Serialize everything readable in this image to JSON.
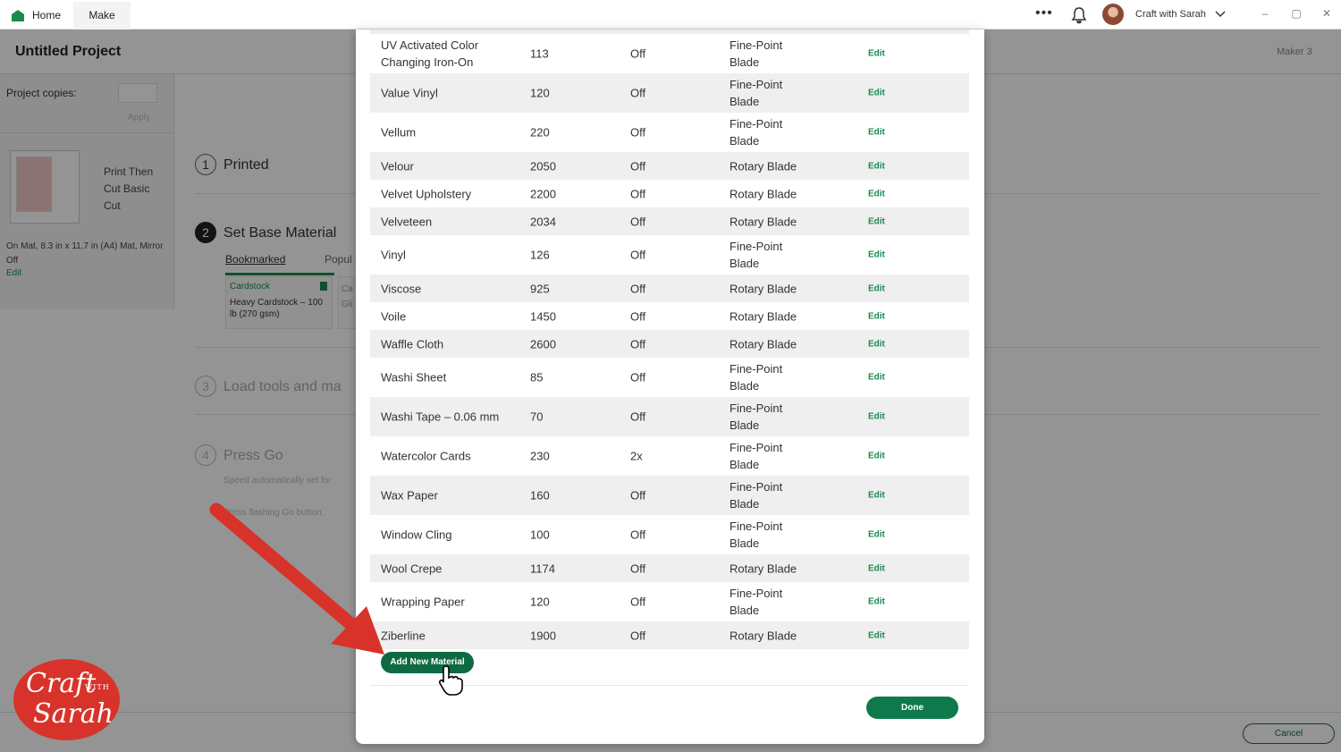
{
  "titlebar": {
    "tabs": [
      {
        "label": "Home"
      },
      {
        "label": "Make"
      }
    ],
    "account_name": "Craft with Sarah",
    "more": "•••",
    "win_min": "–",
    "win_max": "▢",
    "win_close": "✕"
  },
  "app": {
    "project_title": "Untitled Project",
    "machine": "Maker 3",
    "project_copies_label": "Project copies:",
    "apply_label": "Apply",
    "mat_type": "Print Then Cut Basic Cut",
    "mat_info": "On Mat, 8.3 in x 11.7 in (A4) Mat, Mirror Off",
    "mat_edit": "Edit",
    "steps": [
      {
        "num": "1",
        "label": "Printed"
      },
      {
        "num": "2",
        "label": "Set Base Material"
      },
      {
        "num": "3",
        "label": "Load tools and ma"
      },
      {
        "num": "4",
        "label": "Press Go"
      }
    ],
    "subtabs": {
      "bookmarked": "Bookmarked",
      "popular": "Popul"
    },
    "card": {
      "category": "Cardstock",
      "name": "Heavy Cardstock – 100 lb (270 gsm)"
    },
    "card2": {
      "category": "Ca",
      "name": "Gli"
    },
    "speed_text": "Speed automatically set for",
    "flash_text": "Press flashing Go button.",
    "cancel_label": "Cancel"
  },
  "materials": [
    {
      "name": "UV Activated Color Changing Iron-On",
      "pressure": "113",
      "multi_cut": "Off",
      "blade": "Fine-Point Blade",
      "edit": "Edit"
    },
    {
      "name": "Value Vinyl",
      "pressure": "120",
      "multi_cut": "Off",
      "blade": "Fine-Point Blade",
      "edit": "Edit"
    },
    {
      "name": "Vellum",
      "pressure": "220",
      "multi_cut": "Off",
      "blade": "Fine-Point Blade",
      "edit": "Edit"
    },
    {
      "name": "Velour",
      "pressure": "2050",
      "multi_cut": "Off",
      "blade": "Rotary Blade",
      "edit": "Edit"
    },
    {
      "name": "Velvet Upholstery",
      "pressure": "2200",
      "multi_cut": "Off",
      "blade": "Rotary Blade",
      "edit": "Edit"
    },
    {
      "name": "Velveteen",
      "pressure": "2034",
      "multi_cut": "Off",
      "blade": "Rotary Blade",
      "edit": "Edit"
    },
    {
      "name": "Vinyl",
      "pressure": "126",
      "multi_cut": "Off",
      "blade": "Fine-Point Blade",
      "edit": "Edit"
    },
    {
      "name": "Viscose",
      "pressure": "925",
      "multi_cut": "Off",
      "blade": "Rotary Blade",
      "edit": "Edit"
    },
    {
      "name": "Voile",
      "pressure": "1450",
      "multi_cut": "Off",
      "blade": "Rotary Blade",
      "edit": "Edit"
    },
    {
      "name": "Waffle Cloth",
      "pressure": "2600",
      "multi_cut": "Off",
      "blade": "Rotary Blade",
      "edit": "Edit"
    },
    {
      "name": "Washi Sheet",
      "pressure": "85",
      "multi_cut": "Off",
      "blade": "Fine-Point Blade",
      "edit": "Edit"
    },
    {
      "name": "Washi Tape – 0.06 mm",
      "pressure": "70",
      "multi_cut": "Off",
      "blade": "Fine-Point Blade",
      "edit": "Edit"
    },
    {
      "name": "Watercolor Cards",
      "pressure": "230",
      "multi_cut": "2x",
      "blade": "Fine-Point Blade",
      "edit": "Edit"
    },
    {
      "name": "Wax Paper",
      "pressure": "160",
      "multi_cut": "Off",
      "blade": "Fine-Point Blade",
      "edit": "Edit"
    },
    {
      "name": "Window Cling",
      "pressure": "100",
      "multi_cut": "Off",
      "blade": "Fine-Point Blade",
      "edit": "Edit"
    },
    {
      "name": "Wool Crepe",
      "pressure": "1174",
      "multi_cut": "Off",
      "blade": "Rotary Blade",
      "edit": "Edit"
    },
    {
      "name": "Wrapping Paper",
      "pressure": "120",
      "multi_cut": "Off",
      "blade": "Fine-Point Blade",
      "edit": "Edit"
    },
    {
      "name": "Ziberline",
      "pressure": "1900",
      "multi_cut": "Off",
      "blade": "Rotary Blade",
      "edit": "Edit"
    }
  ],
  "modal": {
    "add_new_material_label": "Add New Material",
    "done_label": "Done"
  },
  "logo": {
    "line1": "Craft",
    "line2": "WITH",
    "line3": "Sarah"
  },
  "colors": {
    "brand_green": "#0e7a4c",
    "annotation_arrow": "#d8332a"
  }
}
